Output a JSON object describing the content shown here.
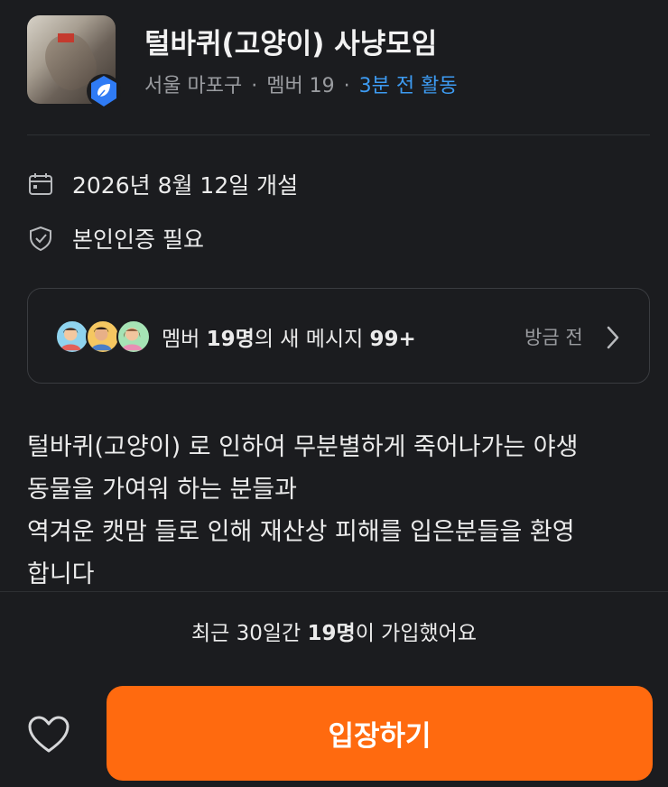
{
  "group": {
    "title": "털바퀴(고양이) 사냥모임",
    "location": "서울 마포구",
    "members": "멤버 19",
    "activity": "3분 전 활동",
    "separator": "·"
  },
  "info": {
    "opened": "2026년 8월 12일 개설",
    "verification": "본인인증 필요"
  },
  "message_card": {
    "prefix": "멤버 ",
    "member_count": "19명",
    "middle": "의 새 메시지 ",
    "message_count": "99+",
    "time": "방금 전"
  },
  "description": {
    "line1": "털바퀴(고양이) 로 인하여 무분별하게 죽어나가는 야생",
    "line2": "동물을 가여워 하는 분들과",
    "line3": "역겨운 캣맘 들로 인해 재산상 피해를 입은분들을 환영",
    "line4": "합니다"
  },
  "footer": {
    "joined_prefix": "최근 30일간 ",
    "joined_count": "19명",
    "joined_suffix": "이 가입했어요",
    "enter_label": "입장하기"
  },
  "colors": {
    "accent": "#ff6a0f",
    "link": "#3d9bf2",
    "background": "#1b1c1f",
    "badge": "#2f7bf5"
  },
  "icons": {
    "calendar": "calendar-icon",
    "shield": "shield-check-icon",
    "chevron": "chevron-right-icon",
    "heart": "heart-outline-icon",
    "verified": "verified-badge-icon"
  }
}
